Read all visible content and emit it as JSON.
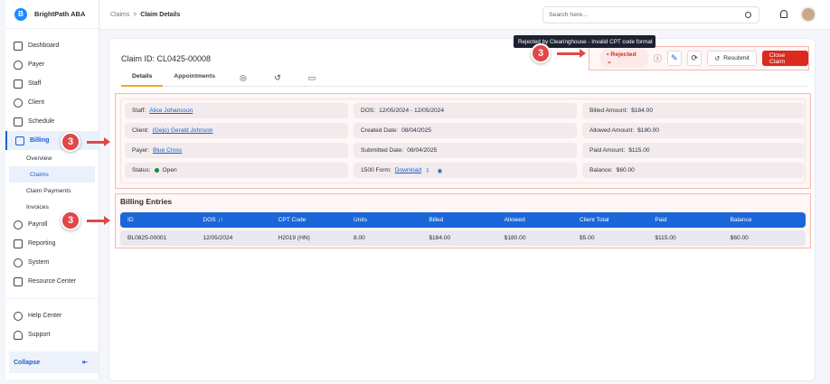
{
  "app": {
    "name": "BrightPath ABA",
    "logo_letter": "B"
  },
  "sidebar": {
    "items": [
      {
        "label": "Dashboard"
      },
      {
        "label": "Payer"
      },
      {
        "label": "Staff"
      },
      {
        "label": "Client"
      },
      {
        "label": "Schedule"
      },
      {
        "label": "Billing"
      }
    ],
    "billing_sub": [
      {
        "label": "Overview"
      },
      {
        "label": "Claims"
      },
      {
        "label": "Claim Payments"
      },
      {
        "label": "Invoices"
      }
    ],
    "items2": [
      {
        "label": "Payroll"
      },
      {
        "label": "Reporting"
      },
      {
        "label": "System"
      },
      {
        "label": "Resource Center"
      }
    ],
    "help": "Help Center",
    "support": "Support",
    "collapse": "Collapse"
  },
  "header": {
    "breadcrumb": [
      "Claims",
      "Claim Details"
    ],
    "separator": ">",
    "search_placeholder": "Search here..."
  },
  "claim": {
    "title": "Claim ID: CL0425-00008",
    "tabs": [
      "Details",
      "Appointments"
    ],
    "status": "Rejected",
    "tooltip": "Rejected by Clearinghouse - Invalid CPT code format",
    "resubmit": "Resubmit",
    "close": "Close Claim"
  },
  "annotation": "3",
  "details": {
    "staff": {
      "label": "Staff:",
      "value": "Alice Johansson"
    },
    "client": {
      "label": "Client:",
      "value": "(Gejo) Gerald Johnson"
    },
    "payer": {
      "label": "Payer:",
      "value": "Blue Cross"
    },
    "status": {
      "label": "Status:",
      "value": "Open"
    },
    "dos": {
      "label": "DOS:",
      "value": "12/05/2024 - 12/05/2024"
    },
    "created": {
      "label": "Created Date:",
      "value": "08/04/2025"
    },
    "submitted": {
      "label": "Submitted Date:",
      "value": "08/04/2025"
    },
    "form": {
      "label": "1500 Form:",
      "value": "Download"
    },
    "billed": {
      "label": "Billed Amount:",
      "value": "$184.00"
    },
    "allowed": {
      "label": "Allowed Amount:",
      "value": "$180.00"
    },
    "paid": {
      "label": "Paid Amount:",
      "value": "$115.00"
    },
    "balance": {
      "label": "Balance:",
      "value": "$60.00"
    }
  },
  "billing": {
    "title": "Billing Entries",
    "columns": [
      "ID",
      "DOS ↓↑",
      "CPT Code",
      "Units",
      "Billed",
      "Allowed",
      "Client Total",
      "Paid",
      "Balance"
    ],
    "rows": [
      [
        "BL0825-00001",
        "12/05/2024",
        "H2019 (HN)",
        "8.00",
        "$184.00",
        "$180.00",
        "$5.00",
        "$115.00",
        "$60.00"
      ]
    ]
  }
}
